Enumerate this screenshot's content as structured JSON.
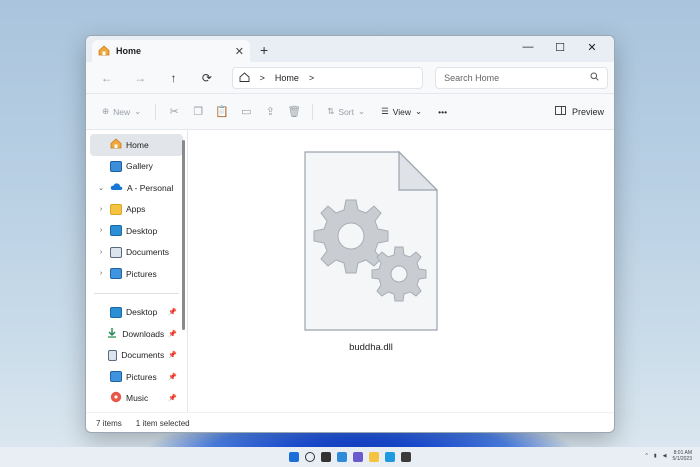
{
  "window": {
    "tab_title": "Home",
    "tab_close": "✕",
    "new_tab": "+",
    "minimize": "—",
    "maximize": "☐",
    "close": "✕"
  },
  "address_bar": {
    "back": "←",
    "forward": "→",
    "up": "↑",
    "refresh": "⟳",
    "home_icon": "home-icon",
    "crumb_sep": ">",
    "crumb": "Home",
    "search_placeholder": "Search Home"
  },
  "command_bar": {
    "new_label": "New",
    "sort_label": "Sort",
    "view_label": "View",
    "more_label": "•••",
    "preview_label": "Preview"
  },
  "sidebar": {
    "top_items": [
      {
        "label": "Home",
        "icon": "home-icon",
        "selected": true
      },
      {
        "label": "Gallery",
        "icon": "gallery-icon"
      },
      {
        "label": "A - Personal",
        "icon": "cloud-icon",
        "chevron": "⌄"
      },
      {
        "label": "Apps",
        "icon": "folder-icon",
        "chevron": "›"
      },
      {
        "label": "Desktop",
        "icon": "desktop-icon",
        "chevron": "›"
      },
      {
        "label": "Documents",
        "icon": "documents-icon",
        "chevron": "›"
      },
      {
        "label": "Pictures",
        "icon": "pictures-icon",
        "chevron": "›"
      }
    ],
    "pinned_items": [
      {
        "label": "Desktop",
        "icon": "desktop-icon"
      },
      {
        "label": "Downloads",
        "icon": "downloads-icon"
      },
      {
        "label": "Documents",
        "icon": "documents-icon"
      },
      {
        "label": "Pictures",
        "icon": "pictures-icon"
      },
      {
        "label": "Music",
        "icon": "music-icon"
      }
    ],
    "pin_glyph": "📌"
  },
  "content": {
    "file_name": "buddha.dll",
    "file_icon": "dll-file-icon"
  },
  "status_bar": {
    "item_count": "7 items",
    "selection": "1 item selected"
  },
  "taskbar": {
    "clock_time": "8:01 AM",
    "clock_date": "5/1/2023"
  },
  "colors": {
    "accent": "#0067c0",
    "folder": "#f5c342",
    "desktop": "#2b8fd6"
  }
}
